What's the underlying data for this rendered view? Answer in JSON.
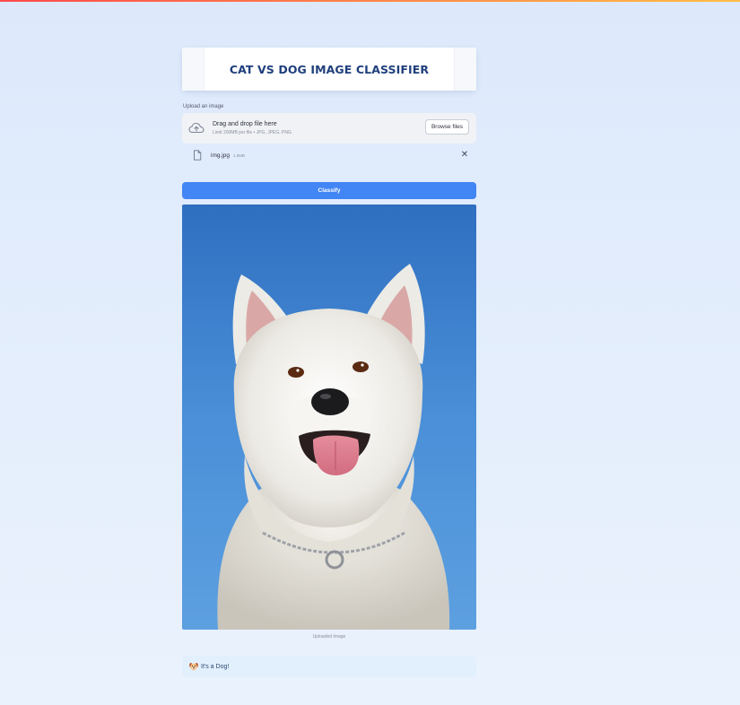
{
  "app": {
    "title": "CAT VS DOG IMAGE CLASSIFIER"
  },
  "uploader": {
    "label": "Upload an image",
    "drop_text": "Drag and drop file here",
    "limit_text": "Limit 200MB per file • JPG, JPEG, PNG",
    "browse_label": "Browse files",
    "icon": "cloud-upload-icon"
  },
  "file": {
    "name": "img.jpg",
    "size": "1.0MB",
    "icon": "file-icon",
    "remove_icon": "close-icon"
  },
  "actions": {
    "classify_label": "Classify"
  },
  "image": {
    "caption": "Uploaded Image",
    "subject": "white dog against blue sky"
  },
  "result": {
    "icon": "dog-face-icon",
    "text": "It's a Dog!"
  },
  "colors": {
    "accent": "#4285f4",
    "title": "#1f3f7c",
    "result_bg": "#e2f0fd"
  }
}
